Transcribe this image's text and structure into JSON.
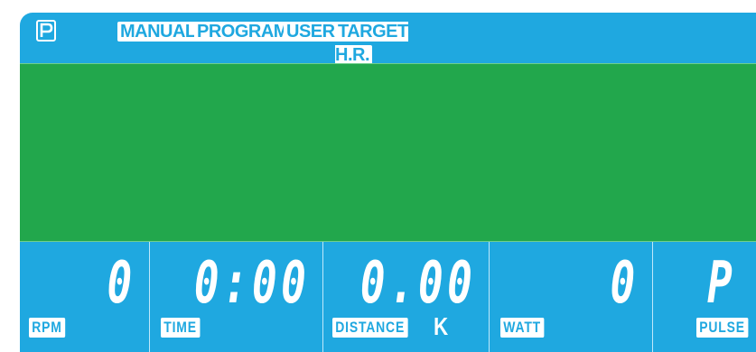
{
  "top_bar": {
    "modes": [
      "MANUAL",
      "PROGRAM",
      "USER",
      "TARGET H.R."
    ]
  },
  "readouts": {
    "rpm": {
      "label": "RPM",
      "value": "0"
    },
    "time": {
      "label": "TIME",
      "value": "0:00"
    },
    "distance": {
      "label": "DISTANCE",
      "value": "0.00",
      "unit": "K"
    },
    "watt": {
      "label": "WATT",
      "value": "0"
    },
    "pulse": {
      "label": "PULSE",
      "value": "P"
    }
  },
  "colors": {
    "lcd_blue": "#1fa8e0",
    "matrix_green": "#22a74c",
    "label_white": "#ffffff"
  }
}
